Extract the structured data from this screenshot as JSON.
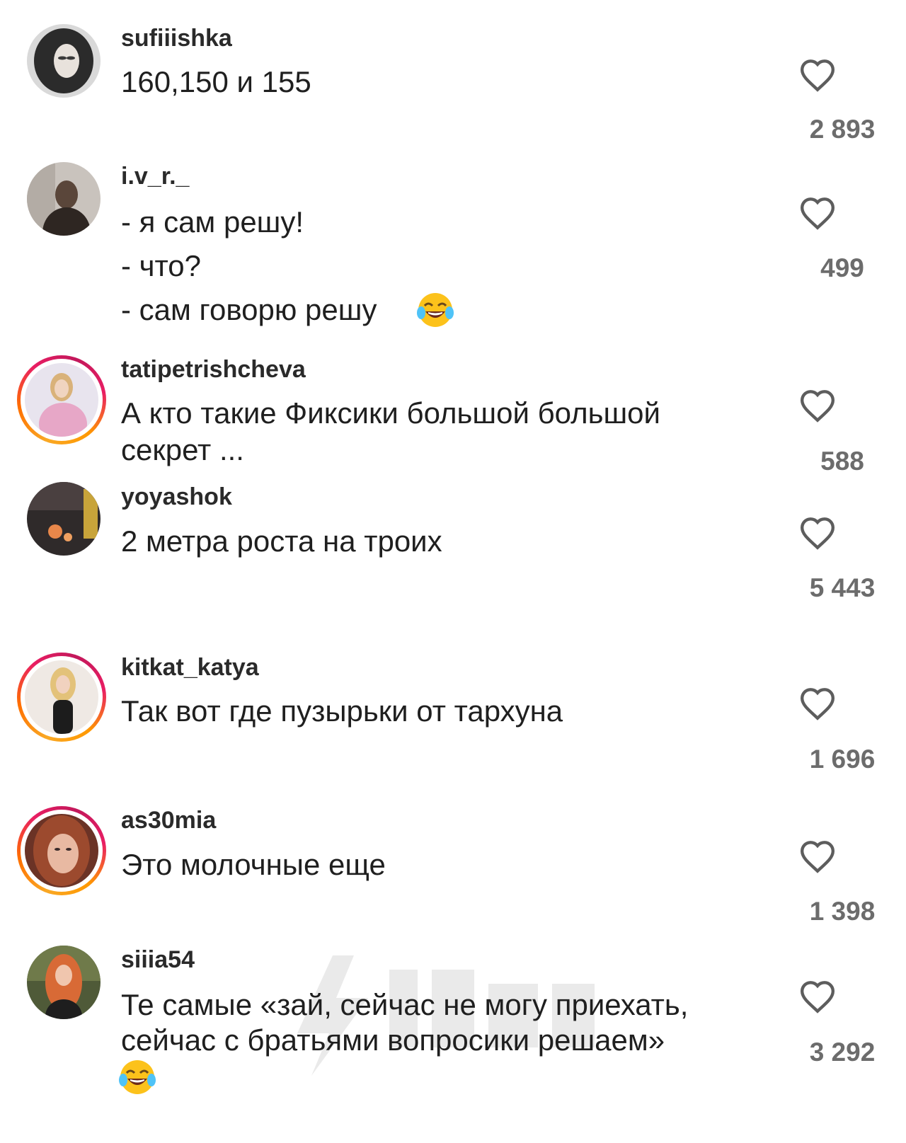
{
  "comments": [
    {
      "username": "sufiiishka",
      "lines": [
        "160,150 и 155"
      ],
      "likes": "2 893",
      "avatar_icon": "user-avatar-photo"
    },
    {
      "username": "i.v_r._",
      "lines": [
        "- я сам решу!",
        "- что?",
        "- сам говорю решу"
      ],
      "likes": "499",
      "avatar_icon": "user-avatar-photo",
      "emoji": "face-with-tears-of-joy"
    },
    {
      "username": "tatipetrishcheva",
      "lines": [
        "А кто такие Фиксики большой большой",
        "секрет ..."
      ],
      "likes": "588",
      "avatar_icon": "user-avatar-photo",
      "story_ring": true
    },
    {
      "username": "yoyashok",
      "lines": [
        "2 метра роста на троих"
      ],
      "likes": "5 443",
      "avatar_icon": "user-avatar-photo"
    },
    {
      "username": "kitkat_katya",
      "lines": [
        "Так вот где пузырьки от тархуна"
      ],
      "likes": "1 696",
      "avatar_icon": "user-avatar-photo",
      "story_ring": true
    },
    {
      "username": "as30mia",
      "lines": [
        "Это молочные еще"
      ],
      "likes": "1 398",
      "avatar_icon": "user-avatar-photo",
      "story_ring": true
    },
    {
      "username": "siiia54",
      "lines": [
        "Те самые «зай, сейчас не могу приехать,",
        "сейчас с братьями вопросики решаем»"
      ],
      "likes": "3 292",
      "avatar_icon": "user-avatar-photo",
      "emoji": "face-with-tears-of-joy"
    }
  ],
  "icons": {
    "like": "heart-outline-icon"
  },
  "colors": {
    "story_ring_start": "#f9a825",
    "story_ring_end": "#e91e63",
    "like_count": "#6c6c6c"
  }
}
